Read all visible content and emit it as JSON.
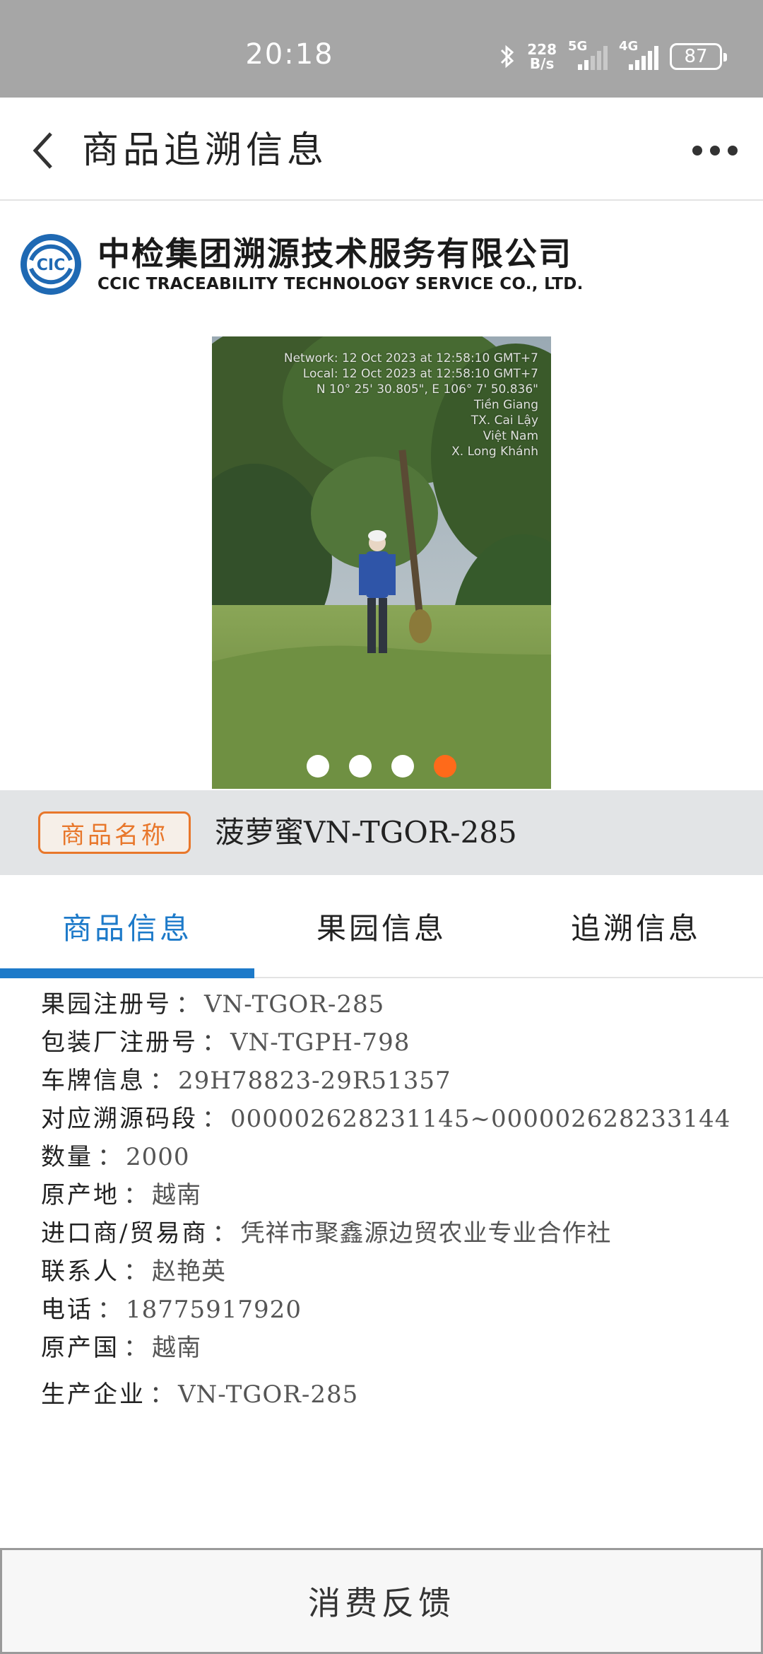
{
  "status_bar": {
    "time": "20:18",
    "net_speed_value": "228",
    "net_speed_unit": "B/s",
    "sim1_label": "5G",
    "sim2_label": "4G",
    "battery": "87"
  },
  "header": {
    "title": "商品追溯信息",
    "back_icon": "chevron-left-icon",
    "more_icon": "more-dots-icon"
  },
  "company": {
    "name_cn": "中检集团溯源技术服务有限公司",
    "name_en": "CCIC TRACEABILITY TECHNOLOGY SERVICE CO., LTD.",
    "logo_text": "CIC"
  },
  "carousel": {
    "stamp_lines": [
      "Network: 12 Oct 2023 at 12:58:10 GMT+7",
      "Local: 12 Oct 2023 at 12:58:10 GMT+7",
      "N 10° 25' 30.805\", E 106° 7' 50.836\"",
      "Tiền Giang",
      "TX. Cai Lậy",
      "Việt Nam",
      "X. Long Khánh"
    ],
    "slide_count": 4,
    "active_index": 3,
    "colors": {
      "active": "#ff6a1a",
      "inactive": "#ffffff"
    }
  },
  "product": {
    "badge_label": "商品名称",
    "name": "菠萝蜜VN-TGOR-285"
  },
  "tabs": [
    {
      "label": "商品信息",
      "active": true
    },
    {
      "label": "果园信息",
      "active": false
    },
    {
      "label": "追溯信息",
      "active": false
    }
  ],
  "info": [
    {
      "label": "果园注册号",
      "value": "VN-TGOR-285"
    },
    {
      "label": "包装厂注册号",
      "value": "VN-TGPH-798"
    },
    {
      "label": "车牌信息",
      "value": "29H78823-29R51357"
    },
    {
      "label": "对应溯源码段",
      "value": "000002628231145~000002628233144"
    },
    {
      "label": "数量",
      "value": "2000"
    },
    {
      "label": "原产地",
      "value": "越南"
    },
    {
      "label": "进口商/贸易商",
      "value": "凭祥市聚鑫源边贸农业专业合作社"
    },
    {
      "label": "联系人",
      "value": "赵艳英"
    },
    {
      "label": "电话",
      "value": "18775917920"
    },
    {
      "label": "原产国",
      "value": "越南"
    },
    {
      "label": "生产企业",
      "value": "VN-TGOR-285"
    }
  ],
  "info_separator": "：",
  "footer": {
    "feedback_label": "消费反馈"
  },
  "colors": {
    "accent_blue": "#1d7ac9",
    "accent_orange": "#e8772b",
    "status_bar": "#a6a6a6"
  }
}
